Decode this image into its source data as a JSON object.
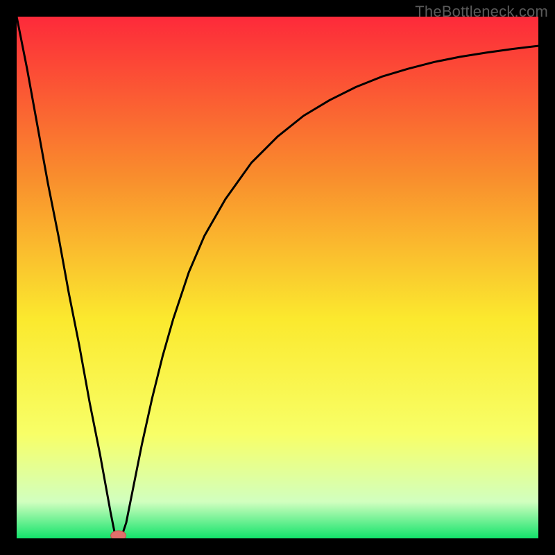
{
  "watermark": "TheBottleneck.com",
  "colors": {
    "frame": "#000000",
    "gradient_top": "#fd2a3a",
    "gradient_upper_mid": "#f98b2d",
    "gradient_mid": "#fbe92e",
    "gradient_lower_mid": "#f8ff67",
    "gradient_near_bottom": "#d1ffbf",
    "gradient_bottom": "#12e36b",
    "curve": "#000000",
    "marker_fill": "#e06f6b",
    "marker_stroke": "#c94f4b"
  },
  "chart_data": {
    "type": "line",
    "title": "",
    "xlabel": "",
    "ylabel": "",
    "xlim": [
      0,
      100
    ],
    "ylim": [
      0,
      100
    ],
    "series": [
      {
        "name": "bottleneck-curve",
        "x": [
          0,
          2,
          4,
          6,
          8,
          10,
          12,
          14,
          16,
          18,
          19,
          20,
          21,
          22,
          24,
          26,
          28,
          30,
          33,
          36,
          40,
          45,
          50,
          55,
          60,
          65,
          70,
          75,
          80,
          85,
          90,
          95,
          100
        ],
        "y": [
          100,
          90,
          79,
          68,
          58,
          47,
          37,
          26,
          16,
          5,
          0,
          0,
          3,
          8,
          18,
          27,
          35,
          42,
          51,
          58,
          65,
          72,
          77,
          81,
          84,
          86.5,
          88.5,
          90,
          91.3,
          92.3,
          93.1,
          93.8,
          94.4
        ]
      }
    ],
    "marker": {
      "name": "bottleneck-minimum",
      "x": 19.5,
      "y": 0
    }
  }
}
